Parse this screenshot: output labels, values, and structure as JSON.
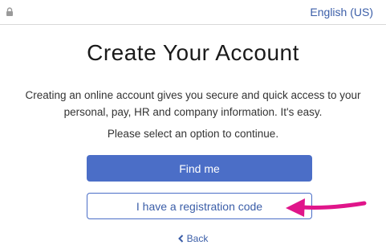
{
  "header": {
    "language_label": "English (US)",
    "lock_icon": "lock-icon"
  },
  "main": {
    "title": "Create Your Account",
    "intro": "Creating an online account gives you secure and quick access to your personal, pay, HR and company information. It's easy.",
    "prompt": "Please select an option to continue.",
    "find_me_label": "Find me",
    "registration_code_label": "I have a registration code",
    "back_label": "Back",
    "back_icon": "chevron-left-icon"
  },
  "annotation": {
    "arrow_color": "#e0158a"
  },
  "colors": {
    "primary": "#4b6ec7",
    "link": "#3b5ea8"
  }
}
